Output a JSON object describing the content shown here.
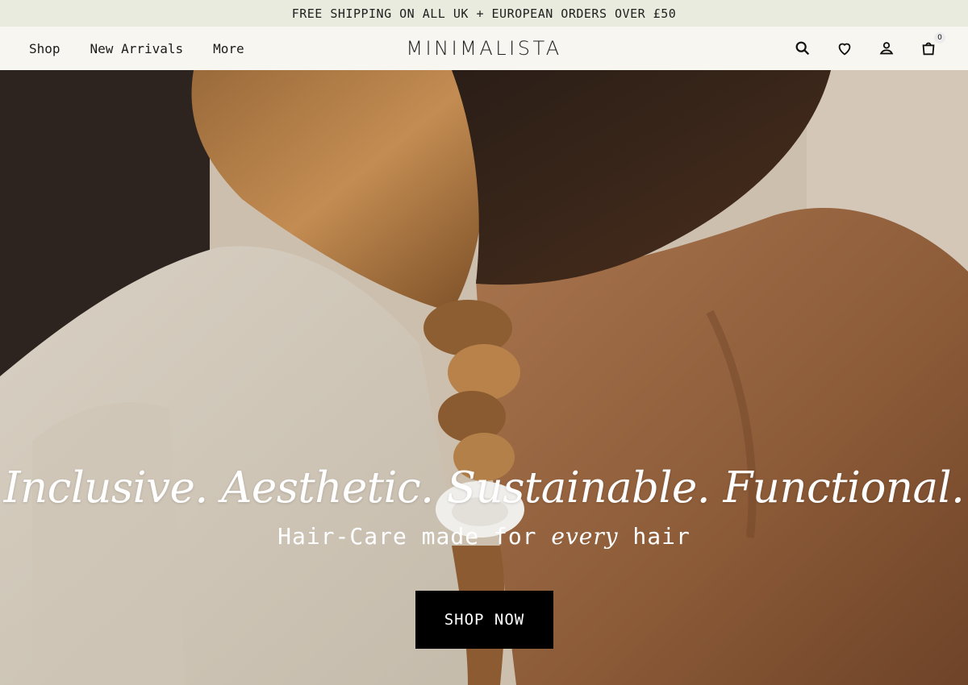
{
  "announcement": {
    "text": "FREE SHIPPING ON ALL UK + EUROPEAN ORDERS OVER £50"
  },
  "header": {
    "nav": [
      {
        "label": "Shop"
      },
      {
        "label": "New Arrivals"
      },
      {
        "label": "More"
      }
    ],
    "logo": "MINIMALISTA",
    "icons": [
      "search-icon",
      "heart-icon",
      "account-icon",
      "bag-icon"
    ],
    "cart_count": "0"
  },
  "hero": {
    "headline": "Inclusive. Aesthetic. Sustainable. Functional.",
    "subhead_before": "Hair-Care made for ",
    "subhead_em": "every",
    "subhead_after": " hair",
    "cta": "SHOP NOW"
  },
  "colors": {
    "announcement_bg": "#e8ebdd",
    "header_bg": "#f8f6f0",
    "cta_bg": "#000000",
    "cta_text": "#ffffff"
  }
}
